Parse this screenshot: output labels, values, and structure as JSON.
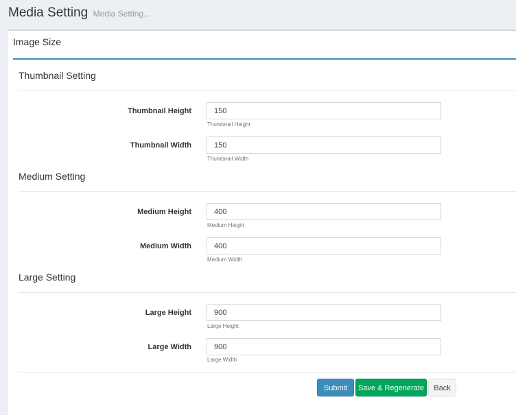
{
  "header": {
    "title": "Media Setting",
    "subtitle": "Media Setting..."
  },
  "box": {
    "title": "Image Size"
  },
  "sections": [
    {
      "title": "Thumbnail Setting",
      "fields": [
        {
          "label": "Thumbnail Height",
          "value": "150",
          "help": "Thumbnail Height"
        },
        {
          "label": "Thumbnail Width",
          "value": "150",
          "help": "Thumbnail Width"
        }
      ]
    },
    {
      "title": "Medium Setting",
      "fields": [
        {
          "label": "Medium Height",
          "value": "400",
          "help": "Medium Height"
        },
        {
          "label": "Medium Width",
          "value": "400",
          "help": "Medium Width"
        }
      ]
    },
    {
      "title": "Large Setting",
      "fields": [
        {
          "label": "Large Height",
          "value": "900",
          "help": "Large Height"
        },
        {
          "label": "Large Width",
          "value": "900",
          "help": "Large Width"
        }
      ]
    }
  ],
  "buttons": {
    "submit": "Submit",
    "save_regenerate": "Save & Regenerate",
    "back": "Back"
  },
  "colors": {
    "accent": "#3c8dbc",
    "submit": "#3c8dbc",
    "save": "#00a65a",
    "back": "#f4f4f4"
  }
}
